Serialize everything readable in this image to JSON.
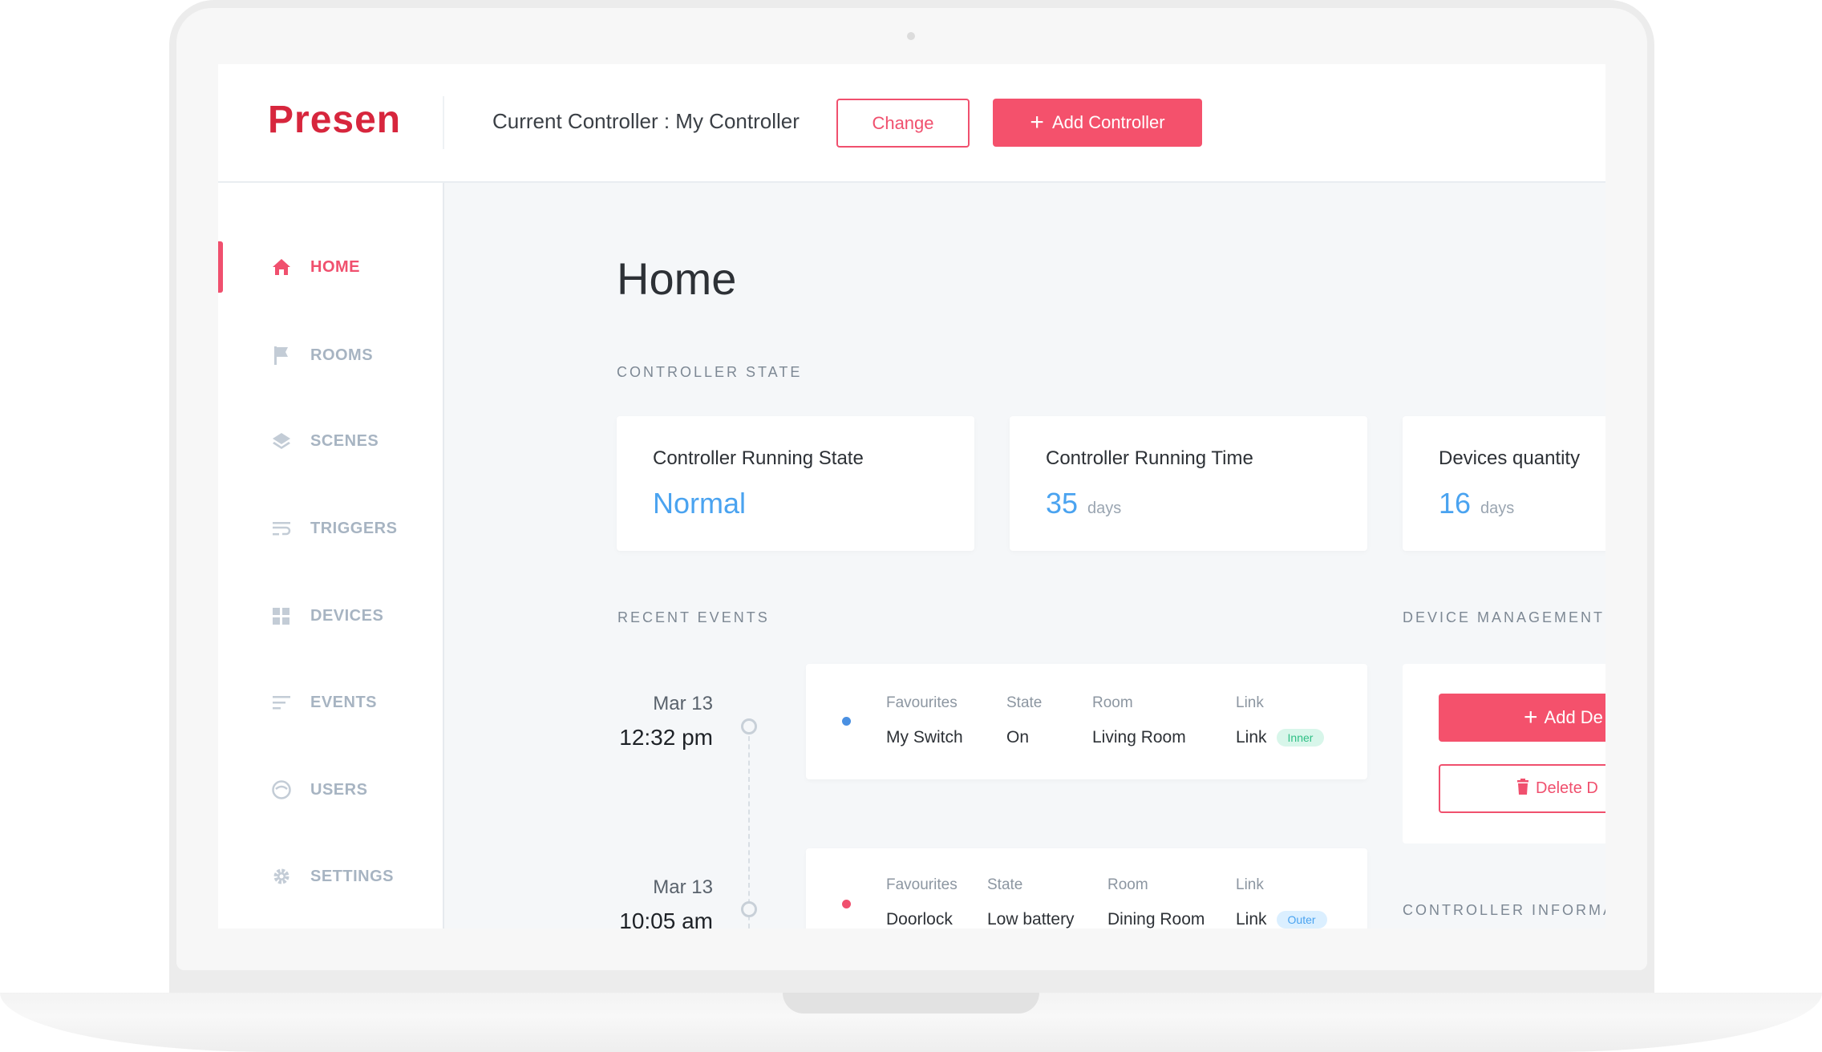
{
  "header": {
    "logo": "Presen",
    "current_controller": "Current Controller : My Controller",
    "change_label": "Change",
    "add_controller_label": "Add Controller"
  },
  "sidebar": {
    "items": [
      {
        "label": "HOME",
        "icon": "home-icon",
        "active": true
      },
      {
        "label": "ROOMS",
        "icon": "flag-icon",
        "active": false
      },
      {
        "label": "SCENES",
        "icon": "layers-icon",
        "active": false
      },
      {
        "label": "TRIGGERS",
        "icon": "wrap-lines-icon",
        "active": false
      },
      {
        "label": "DEVICES",
        "icon": "grid-icon",
        "active": false
      },
      {
        "label": "EVENTS",
        "icon": "list-icon",
        "active": false
      },
      {
        "label": "USERS",
        "icon": "smiley-icon",
        "active": false
      },
      {
        "label": "SETTINGS",
        "icon": "gear-icon",
        "active": false
      }
    ]
  },
  "main": {
    "title": "Home",
    "controller_state_label": "CONTROLLER STATE",
    "state_cards": [
      {
        "title": "Controller Running State",
        "value": "Normal",
        "unit": ""
      },
      {
        "title": "Controller Running Time",
        "value": "35",
        "unit": "days"
      },
      {
        "title": "Devices quantity",
        "value": "16",
        "unit": "days"
      }
    ],
    "recent_events_label": "RECENT EVENTS",
    "events": [
      {
        "date": "Mar 13",
        "time": "12:32 pm",
        "dot_color": "#4a90e2",
        "headers": [
          "Favourites",
          "State",
          "Room",
          "Link"
        ],
        "values": [
          "My Switch",
          "On",
          "Living Room",
          "Link"
        ],
        "badge": "Inner"
      },
      {
        "date": "Mar 13",
        "time": "10:05 am",
        "dot_color": "#f0506e",
        "headers": [
          "Favourites",
          "State",
          "Room",
          "Link"
        ],
        "values": [
          "Doorlock",
          "Low battery",
          "Dining Room",
          "Link"
        ],
        "badge": "Outer"
      }
    ],
    "device_management_label": "DEVICE MANAGEMENT",
    "add_device_label": "Add De",
    "delete_device_label": "Delete D",
    "controller_information_label": "CONTROLLER INFORMA"
  },
  "colors": {
    "accent": "#f4516c",
    "value_blue": "#4aa3f0",
    "nav_inactive": "#a7b4c2"
  }
}
